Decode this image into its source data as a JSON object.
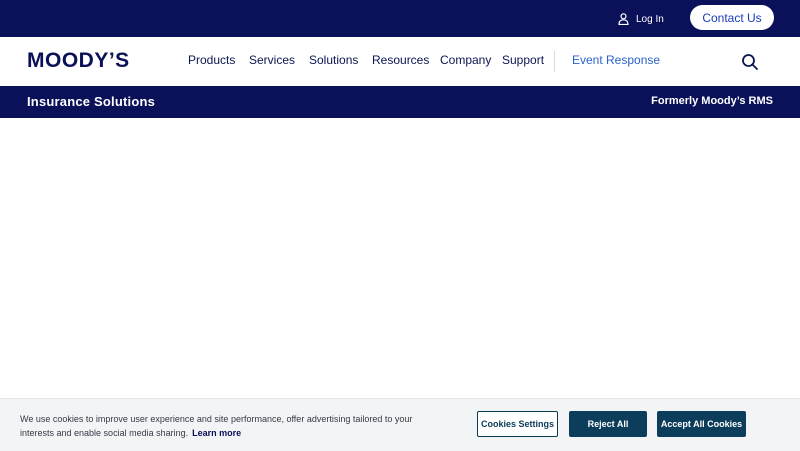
{
  "topbar": {
    "login_label": "Log In",
    "login_icon": "user-icon",
    "contact_label": "Contact Us",
    "background": "#0a1158"
  },
  "nav": {
    "logo_text": "MOODY’S",
    "items": [
      {
        "label": "Products"
      },
      {
        "label": "Services"
      },
      {
        "label": "Solutions"
      },
      {
        "label": "Resources"
      },
      {
        "label": "Company"
      },
      {
        "label": "Support"
      }
    ],
    "event_label": "Event Response",
    "search_icon": "search-icon"
  },
  "subbar": {
    "title": "Insurance Solutions",
    "right_text": "Formerly Moody’s RMS"
  },
  "cookie_banner": {
    "text": "We use cookies to improve user experience and site performance, offer advertising tailored to your interests and enable social media sharing.",
    "learn_more": "Learn more",
    "settings_label": "Cookies Settings",
    "reject_label": "Reject All",
    "accept_label": "Accept All Cookies",
    "button_color": "#0c3d5a"
  }
}
